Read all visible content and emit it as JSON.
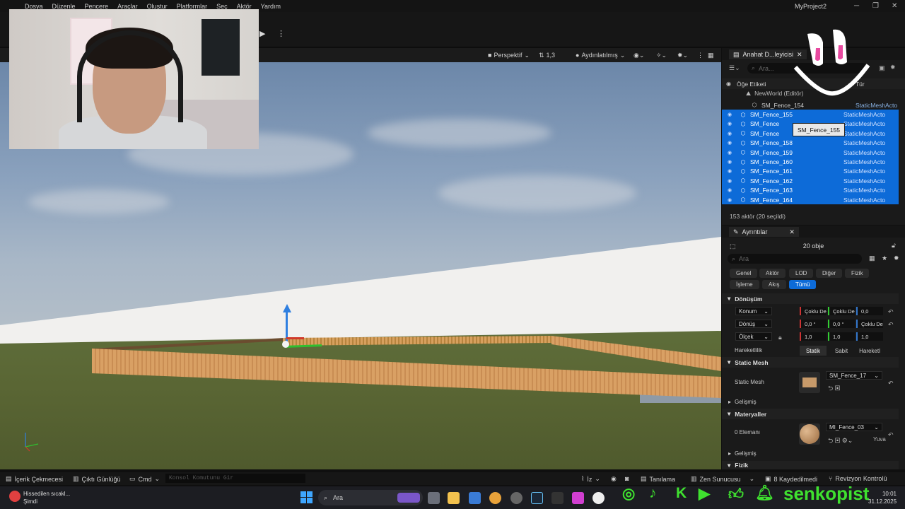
{
  "menu": {
    "items": [
      "Dosya",
      "Düzenle",
      "Pencere",
      "Araçlar",
      "Oluştur",
      "Platformlar",
      "Seç",
      "Aktör",
      "Yardım"
    ],
    "project_title": "MyProject2"
  },
  "viewport": {
    "perspective": "Perspektif",
    "speed": "1,3",
    "lighting": "Aydınlatılmış"
  },
  "outliner": {
    "tab_label": "Anahat D...leyicisi",
    "search_placeholder": "Ara...",
    "item_label_header": "Öğe Etiketi",
    "type_header": "Tür",
    "world": "NewWorld (Editör)",
    "rows": [
      {
        "name": "SM_Fence_154",
        "type": "StaticMeshActo",
        "selected": false
      },
      {
        "name": "SM_Fence_155",
        "type": "StaticMeshActo",
        "selected": true
      },
      {
        "name": "SM_Fence",
        "type": "StaticMeshActo",
        "selected": true
      },
      {
        "name": "SM_Fence",
        "type": "StaticMeshActo",
        "selected": true
      },
      {
        "name": "SM_Fence_158",
        "type": "StaticMeshActo",
        "selected": true
      },
      {
        "name": "SM_Fence_159",
        "type": "StaticMeshActo",
        "selected": true
      },
      {
        "name": "SM_Fence_160",
        "type": "StaticMeshActo",
        "selected": true
      },
      {
        "name": "SM_Fence_161",
        "type": "StaticMeshActo",
        "selected": true
      },
      {
        "name": "SM_Fence_162",
        "type": "StaticMeshActo",
        "selected": true
      },
      {
        "name": "SM_Fence_163",
        "type": "StaticMeshActo",
        "selected": true
      },
      {
        "name": "SM_Fence_164",
        "type": "StaticMeshActo",
        "selected": true
      }
    ],
    "tooltip": "SM_Fence_155",
    "status": "153 aktör (20 seçildi)"
  },
  "details": {
    "tab_label": "Ayrıntılar",
    "object_count": "20 obje",
    "search_placeholder": "Ara",
    "filters_row1": [
      "Genel",
      "Aktör",
      "LOD",
      "Diğer",
      "Fizik"
    ],
    "filters_row2": [
      "İşleme",
      "Akış",
      "Tümü"
    ],
    "transform_section": "Dönüşüm",
    "location_label": "Konum",
    "rotation_label": "Dönüş",
    "scale_label": "Ölçek",
    "location_values": [
      "Çoklu De",
      "Çoklu De",
      "0,0"
    ],
    "rotation_values": [
      "0,0 °",
      "0,0 °",
      "Çoklu De"
    ],
    "scale_values": [
      "1,0",
      "1,0",
      "1,0"
    ],
    "mobility_label": "Hareketlilik",
    "mobility_options": [
      "Statik",
      "Sabit",
      "Hareketl"
    ],
    "static_mesh_section": "Static Mesh",
    "static_mesh_label": "Static Mesh",
    "static_mesh_value": "SM_Fence_17",
    "advanced_label": "Gelişmiş",
    "materials_section": "Materyaller",
    "element_label": "0 Elemanı",
    "material_value": "MI_Fence_03",
    "material_extra": "Yuva",
    "advanced_label2": "Gelişmiş",
    "physics_section": "Fizik"
  },
  "bottombar": {
    "content_drawer": "İçerik Çekmecesi",
    "output_log": "Çıktı Günlüğü",
    "cmd": "Cmd",
    "cmd_placeholder": "Konsol Komutunu Gir",
    "trace": "İz",
    "derive": "Tanılama",
    "zen": "Zen Sunucusu",
    "unsaved": "8 Kaydedilmedi",
    "revision": "Revizyon Kontrolü"
  },
  "taskbar": {
    "weather_line1": "Hissedilen sıcakl...",
    "weather_line2": "Şimdi",
    "search_label": "Ara",
    "brand": "senkopist",
    "time": "10:01",
    "date": "31.12.2025"
  }
}
